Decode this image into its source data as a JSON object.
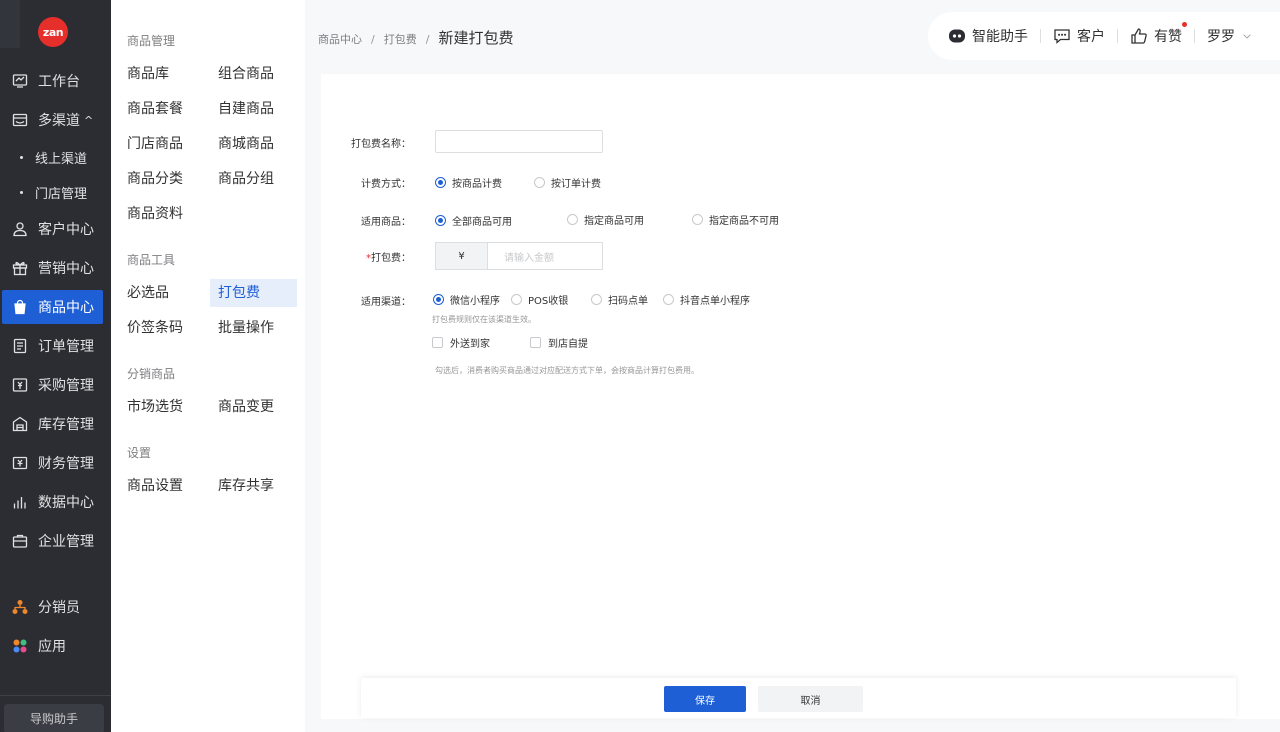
{
  "brand": {
    "logo_text": "zan",
    "color": "#e62e2b"
  },
  "rail": {
    "items": [
      {
        "label": "工作台",
        "icon": "dashboard-icon"
      },
      {
        "label": "多渠道",
        "icon": "store-icon",
        "arrow": "^"
      },
      {
        "label": "客户中心",
        "icon": "user-icon"
      },
      {
        "label": "营销中心",
        "icon": "gift-icon"
      },
      {
        "label": "商品中心",
        "icon": "bag-icon",
        "active": true
      },
      {
        "label": "订单管理",
        "icon": "order-icon"
      },
      {
        "label": "采购管理",
        "icon": "purchase-icon"
      },
      {
        "label": "库存管理",
        "icon": "warehouse-icon"
      },
      {
        "label": "财务管理",
        "icon": "finance-icon"
      },
      {
        "label": "数据中心",
        "icon": "chart-icon"
      },
      {
        "label": "企业管理",
        "icon": "briefcase-icon"
      },
      {
        "label": "分销员",
        "icon": "distribution-icon"
      },
      {
        "label": "应用",
        "icon": "apps-icon"
      }
    ],
    "subitems": [
      "线上渠道",
      "门店管理"
    ],
    "bottom_button": "导购助手"
  },
  "subnav": {
    "groups": [
      {
        "title": "商品管理"
      },
      {
        "title": "商品工具"
      },
      {
        "title": "分销商品"
      },
      {
        "title": "设置"
      }
    ],
    "items": {
      "a1": "商品库",
      "a2": "组合商品",
      "a3": "商品套餐",
      "a4": "自建商品",
      "a5": "门店商品",
      "a6": "商城商品",
      "a7": "商品分类",
      "a8": "商品分组",
      "a9": "商品资料",
      "b1": "必选品",
      "b2": "打包费",
      "b3": "价签条码",
      "b4": "批量操作",
      "c1": "市场选货",
      "c2": "商品变更",
      "d1": "商品设置",
      "d2": "库存共享"
    }
  },
  "breadcrumb": {
    "level1": "商品中心",
    "level2": "打包费",
    "current": "新建打包费",
    "separator": "/"
  },
  "topbar": {
    "assistant": "智能助手",
    "customer": "客户",
    "like": "有赞",
    "user": "罗罗"
  },
  "form": {
    "name_label": "打包费名称：",
    "name_value": "",
    "billing_label": "计费方式：",
    "billing_options": [
      "按商品计费",
      "按订单计费"
    ],
    "billing_selected": "按商品计费",
    "goods_label": "适用商品：",
    "goods_options": [
      "全部商品可用",
      "指定商品可用",
      "指定商品不可用"
    ],
    "goods_selected": "全部商品可用",
    "fee_required_mark": "*",
    "fee_label": "打包费：",
    "fee_prefix": "¥",
    "fee_placeholder": "请输入金额",
    "channel_label": "适用渠道：",
    "channel_options": [
      "微信小程序",
      "POS收银",
      "扫码点单",
      "抖音点单小程序"
    ],
    "channel_selected": "微信小程序",
    "channel_hint": "打包费规则仅在该渠道生效。",
    "delivery_options": [
      "外送到家",
      "到店自提"
    ],
    "delivery_hint": "勾选后，消费者购买商品通过对应配送方式下单，会按商品计算打包费用。"
  },
  "footer": {
    "save": "保存",
    "cancel": "取消"
  },
  "colors": {
    "primary": "#1e5fd6",
    "rail_bg": "#2b2d33",
    "danger": "#e62e2b"
  }
}
